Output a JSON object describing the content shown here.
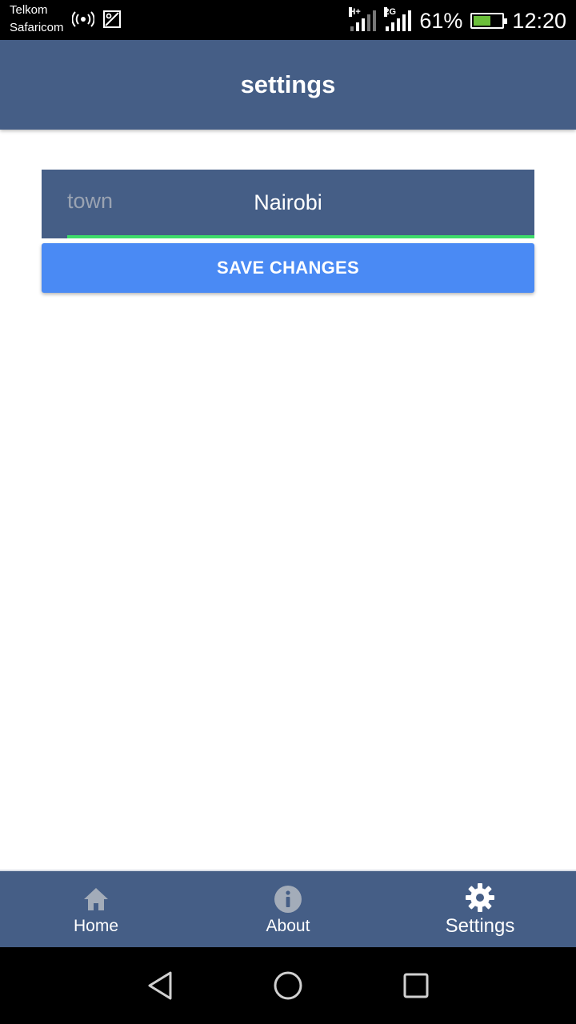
{
  "status_bar": {
    "carrier_1": "Telkom",
    "carrier_2": "Safaricom",
    "battery_percent": "61%",
    "battery_level": 0.61,
    "time": "12:20",
    "network_1": "H+",
    "network_2": "2G"
  },
  "app_bar": {
    "title": "settings"
  },
  "form": {
    "town_label": "town",
    "town_value": "Nairobi",
    "save_label": "SAVE CHANGES"
  },
  "tabs": [
    {
      "label": "Home",
      "icon": "home-icon"
    },
    {
      "label": "About",
      "icon": "info-icon"
    },
    {
      "label": "Settings",
      "icon": "gear-icon",
      "active": true
    }
  ],
  "colors": {
    "primary": "#455e86",
    "button": "#4a8af4",
    "underline": "#3ddc6a"
  }
}
